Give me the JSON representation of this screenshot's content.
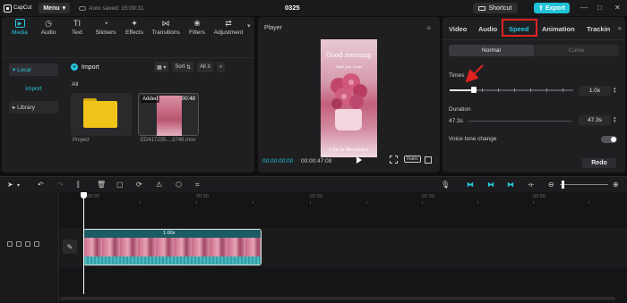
{
  "app": {
    "logo_text": "CapCut",
    "menu_label": "Menu",
    "autosave_text": "Auto saved: 15:09:31",
    "project_title": "0325",
    "shortcut_label": "Shortcut",
    "export_label": "Export"
  },
  "media": {
    "tools": [
      {
        "label": "Media",
        "icon": "media-icon"
      },
      {
        "label": "Audio",
        "icon": "audio-icon"
      },
      {
        "label": "Text",
        "icon": "text-icon"
      },
      {
        "label": "Stickers",
        "icon": "stickers-icon"
      },
      {
        "label": "Effects",
        "icon": "effects-icon"
      },
      {
        "label": "Transitions",
        "icon": "transitions-icon"
      },
      {
        "label": "Filters",
        "icon": "filters-icon"
      },
      {
        "label": "Adjustment",
        "icon": "adjustment-icon"
      }
    ],
    "nav": {
      "local": "Local",
      "import": "Import",
      "library": "Library"
    },
    "import_label": "Import",
    "sort_label": "Sort",
    "all_filter": "All",
    "all_label": "All",
    "items": [
      {
        "name": "Project"
      },
      {
        "name": "ED417235....3748.mov",
        "badge": "Added",
        "duration": "00:48"
      }
    ]
  },
  "player": {
    "title": "Player",
    "frame_title": "Good morning",
    "frame_subtitle": "Glad you came",
    "frame_caption": "Life is Beautiful",
    "current_time": "00:00:00:00",
    "total_time": "00:00:47:09",
    "ratio_label": "Ratio"
  },
  "inspector": {
    "tabs": [
      "Video",
      "Audio",
      "Speed",
      "Animation",
      "Trackin"
    ],
    "active_tab": "Speed",
    "highlight_color": "#e0231f",
    "modes": [
      "Normal",
      "Curve"
    ],
    "times_label": "Times",
    "times_value": "1.0x",
    "duration_label": "Duration",
    "duration_old": "47.3s",
    "duration_value": "47.3s",
    "voice_label": "Voice tone change",
    "voice_on": false,
    "redo_label": "Redo"
  },
  "timeline": {
    "ruler": [
      "00:00",
      "00:30",
      "01:00",
      "01:30",
      "02:00"
    ],
    "clip_speed": "1.00x",
    "accent_color": "#27c6dc"
  }
}
